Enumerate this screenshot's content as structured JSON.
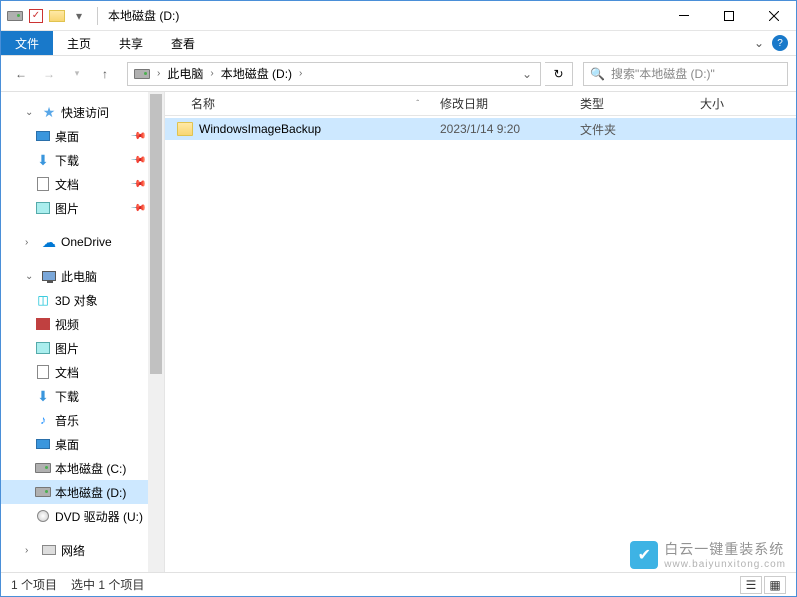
{
  "title": "本地磁盘 (D:)",
  "ribbon": {
    "file": "文件",
    "home": "主页",
    "share": "共享",
    "view": "查看"
  },
  "breadcrumb": {
    "pc": "此电脑",
    "drive": "本地磁盘 (D:)"
  },
  "search": {
    "placeholder": "搜索\"本地磁盘 (D:)\""
  },
  "columns": {
    "name": "名称",
    "date": "修改日期",
    "type": "类型",
    "size": "大小"
  },
  "files": [
    {
      "name": "WindowsImageBackup",
      "date": "2023/1/14 9:20",
      "type": "文件夹"
    }
  ],
  "sidebar": {
    "quick": "快速访问",
    "desktop": "桌面",
    "downloads": "下载",
    "documents": "文档",
    "pictures": "图片",
    "onedrive": "OneDrive",
    "thispc": "此电脑",
    "obj3d": "3D 对象",
    "videos": "视频",
    "pictures2": "图片",
    "documents2": "文档",
    "downloads2": "下载",
    "music": "音乐",
    "desktop2": "桌面",
    "driveC": "本地磁盘 (C:)",
    "driveD": "本地磁盘 (D:)",
    "dvd": "DVD 驱动器 (U:)",
    "network": "网络"
  },
  "status": {
    "count": "1 个项目",
    "selected": "选中 1 个项目"
  },
  "watermark": {
    "brand": "白云一键重装系统",
    "url": "www.baiyunxitong.com"
  }
}
